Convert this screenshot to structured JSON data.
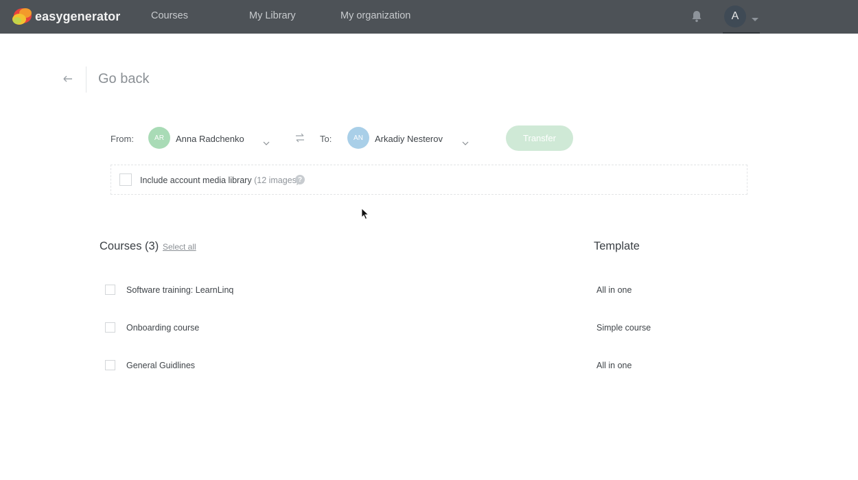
{
  "app": {
    "brand": "easygenerator",
    "accent": "#4d5257"
  },
  "nav": {
    "items": [
      {
        "label": "Courses"
      },
      {
        "label": "My Library"
      },
      {
        "label": "My organization"
      }
    ],
    "avatar_letter": "A",
    "icons": {
      "notifications": "bell-icon",
      "menu": "chevron-down-icon"
    }
  },
  "back": {
    "label": "Go back",
    "icon": "arrow-left-icon"
  },
  "transfer": {
    "from_label": "From:",
    "to_label": "To:",
    "from_user": {
      "initials": "AR",
      "name": "Anna Radchenko",
      "color": "#a9dbb6"
    },
    "to_user": {
      "initials": "AN",
      "name": "Arkadiy Nesterov",
      "color": "#a9cfe8"
    },
    "button_label": "Transfer",
    "button_color": "#cfe9d6",
    "swap_icon": "swap-icon"
  },
  "media": {
    "label": "Include account media library",
    "count": "(12 images)",
    "help": "?",
    "checked": false
  },
  "courses": {
    "title": "Courses (3)",
    "select_all": "Select all",
    "template_header": "Template",
    "rows": [
      {
        "name": "Software training: LearnLinq",
        "template": "All in one",
        "checked": false
      },
      {
        "name": "Onboarding course",
        "template": "Simple course",
        "checked": false
      },
      {
        "name": "General Guidlines",
        "template": "All in one",
        "checked": false
      }
    ]
  }
}
